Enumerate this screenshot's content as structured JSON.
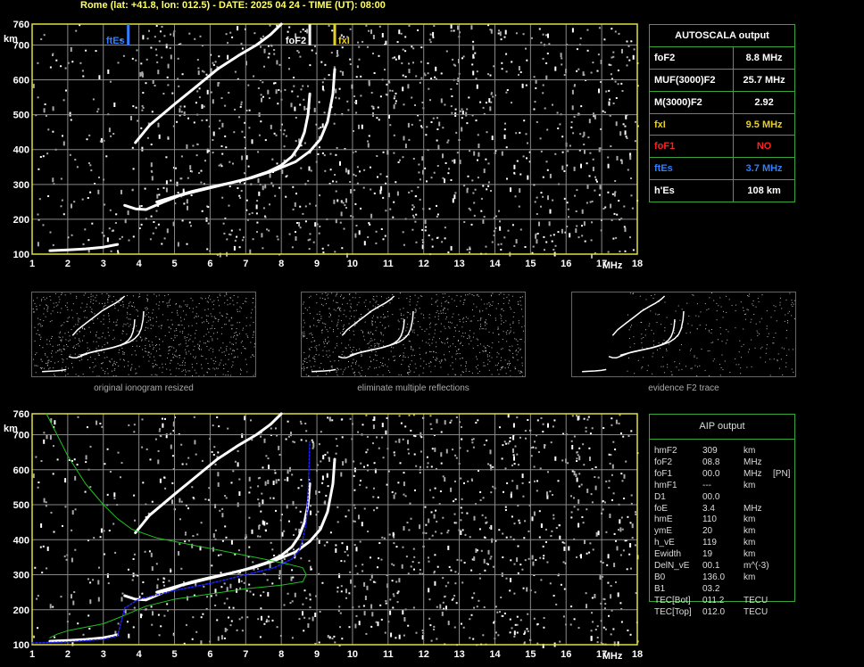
{
  "header": {
    "title": "Rome (lat: +41.8, lon: 012.5) - DATE: 2025 04 24 - TIME (UT): 08:00"
  },
  "autoscala": {
    "title": "AUTOSCALA output",
    "rows": [
      {
        "label": "foF2",
        "value": "8.8 MHz",
        "color": "#ffffff"
      },
      {
        "label": "MUF(3000)F2",
        "value": "25.7 MHz",
        "color": "#ffffff"
      },
      {
        "label": "M(3000)F2",
        "value": "2.92",
        "color": "#ffffff"
      },
      {
        "label": "fxI",
        "value": "9.5 MHz",
        "color": "#e6d02a"
      },
      {
        "label": "foF1",
        "value": "NO",
        "color": "#ff2020"
      },
      {
        "label": "ftEs",
        "value": "3.7 MHz",
        "color": "#2f7fff"
      },
      {
        "label": "h'Es",
        "value": "108     km",
        "color": "#ffffff"
      }
    ]
  },
  "aip": {
    "title": "AIP output",
    "rows": [
      [
        "hmF2",
        "309",
        "km",
        ""
      ],
      [
        "foF2",
        "08.8",
        "MHz",
        ""
      ],
      [
        "foF1",
        "00.0",
        "MHz",
        "[PN]"
      ],
      [
        "hmF1",
        "---",
        "km",
        ""
      ],
      [
        "D1",
        "00.0",
        "",
        ""
      ],
      [
        "foE",
        "3.4",
        "MHz",
        ""
      ],
      [
        "hmE",
        "110",
        "km",
        ""
      ],
      [
        "ymE",
        "20",
        "km",
        ""
      ],
      [
        "h_vE",
        "119",
        "km",
        ""
      ],
      [
        "Ewidth",
        "19",
        "km",
        ""
      ],
      [
        "DelN_vE",
        "00.1",
        "m^(-3)",
        ""
      ],
      [
        "B0",
        "136.0",
        "km",
        ""
      ],
      [
        "B1",
        "03.2",
        "",
        ""
      ],
      [
        "TEC[Bot]",
        "011.2",
        "TECU",
        ""
      ],
      [
        "TEC[Top]",
        "012.0",
        "TECU",
        ""
      ]
    ]
  },
  "thumbnails": [
    {
      "caption": "original ionogram resized"
    },
    {
      "caption": "eliminate multiple reflections"
    },
    {
      "caption": "evidence F2 trace"
    }
  ],
  "colors": {
    "grid": "#888888",
    "frame": "#e0e040",
    "model": "#20c020",
    "profile": "#2020ff",
    "ftEs": "#2f7fff",
    "fxI": "#e6d02a"
  },
  "chart_data": [
    {
      "type": "scatter",
      "title": "",
      "xlabel": "MHz",
      "ylabel": "km",
      "xlim": [
        1,
        18
      ],
      "ylim": [
        100,
        760
      ],
      "x_ticks": [
        1,
        2,
        3,
        4,
        5,
        6,
        7,
        8,
        9,
        10,
        11,
        12,
        13,
        14,
        15,
        16,
        17,
        18
      ],
      "y_ticks": [
        100,
        200,
        300,
        400,
        500,
        600,
        700,
        760
      ],
      "markers": [
        {
          "label": "ftEs",
          "x": 3.7,
          "color": "#2f7fff"
        },
        {
          "label": "foF2",
          "x": 8.8,
          "color": "#ffffff"
        },
        {
          "label": "fxI",
          "x": 9.5,
          "color": "#e6d02a"
        }
      ],
      "series": [
        {
          "x": [
            1.5,
            2.0,
            2.5,
            3.0,
            3.4
          ],
          "y": [
            110,
            112,
            115,
            120,
            128
          ]
        },
        {
          "x": [
            3.6,
            3.9,
            4.2,
            4.7,
            5.2,
            5.8,
            6.4,
            7.0,
            7.6,
            8.0,
            8.3,
            8.5,
            8.65,
            8.75,
            8.8
          ],
          "y": [
            240,
            230,
            228,
            250,
            270,
            285,
            300,
            315,
            335,
            355,
            380,
            410,
            450,
            500,
            560
          ]
        },
        {
          "x": [
            4.5,
            5.0,
            5.5,
            6.0,
            6.6,
            7.2,
            7.8,
            8.4,
            8.8,
            9.1,
            9.3,
            9.45,
            9.5
          ],
          "y": [
            250,
            265,
            280,
            292,
            305,
            320,
            340,
            365,
            395,
            430,
            480,
            560,
            630
          ]
        },
        {
          "x": [
            3.9,
            4.3,
            5.0,
            5.6,
            6.2,
            6.8,
            7.3,
            7.7,
            8.0
          ],
          "y": [
            420,
            470,
            530,
            580,
            630,
            670,
            700,
            730,
            760
          ]
        }
      ]
    },
    {
      "type": "scatter",
      "title": "",
      "xlabel": "MHz",
      "ylabel": "km",
      "xlim": [
        1,
        18
      ],
      "ylim": [
        100,
        760
      ],
      "x_ticks": [
        1,
        2,
        3,
        4,
        5,
        6,
        7,
        8,
        9,
        10,
        11,
        12,
        13,
        14,
        15,
        16,
        17,
        18
      ],
      "y_ticks": [
        100,
        200,
        300,
        400,
        500,
        600,
        700,
        760
      ],
      "series": [
        {
          "x": [
            1.5,
            2.0,
            2.5,
            3.0,
            3.4
          ],
          "y": [
            110,
            112,
            115,
            120,
            128
          ]
        },
        {
          "x": [
            3.6,
            3.9,
            4.2,
            4.7,
            5.2,
            5.8,
            6.4,
            7.0,
            7.6,
            8.0,
            8.3,
            8.5,
            8.65,
            8.75,
            8.8
          ],
          "y": [
            240,
            230,
            228,
            250,
            270,
            285,
            300,
            315,
            335,
            355,
            380,
            410,
            450,
            500,
            560
          ]
        },
        {
          "x": [
            4.5,
            5.0,
            5.5,
            6.0,
            6.6,
            7.2,
            7.8,
            8.4,
            8.8,
            9.1,
            9.3,
            9.45,
            9.5
          ],
          "y": [
            250,
            265,
            280,
            292,
            305,
            320,
            340,
            365,
            395,
            430,
            480,
            560,
            630
          ]
        },
        {
          "x": [
            3.9,
            4.3,
            5.0,
            5.6,
            6.2,
            6.8,
            7.3,
            7.7,
            8.0
          ],
          "y": [
            420,
            470,
            530,
            580,
            630,
            670,
            700,
            730,
            760
          ]
        },
        {
          "x": [
            1.0,
            2.0,
            3.0,
            3.4,
            3.6,
            4.0,
            5.0,
            6.0,
            7.0,
            7.8,
            8.3,
            8.5,
            8.6,
            8.7,
            8.75,
            8.8
          ],
          "y": [
            105,
            108,
            115,
            125,
            205,
            230,
            255,
            275,
            300,
            320,
            345,
            370,
            400,
            450,
            520,
            680
          ]
        },
        {
          "x": [
            1.4,
            1.7,
            2.0,
            2.5,
            3.0,
            3.4,
            3.8,
            4.5,
            5.5,
            6.5,
            7.5,
            8.2,
            8.6,
            8.7,
            8.6,
            8.0,
            7.0,
            6.0,
            5.0,
            4.2,
            3.5,
            3.0,
            2.5,
            2.0,
            1.7,
            1.5
          ],
          "y": [
            760,
            700,
            640,
            560,
            500,
            460,
            430,
            405,
            385,
            365,
            345,
            330,
            320,
            300,
            280,
            270,
            260,
            245,
            230,
            210,
            180,
            160,
            150,
            140,
            130,
            120
          ]
        }
      ]
    }
  ]
}
